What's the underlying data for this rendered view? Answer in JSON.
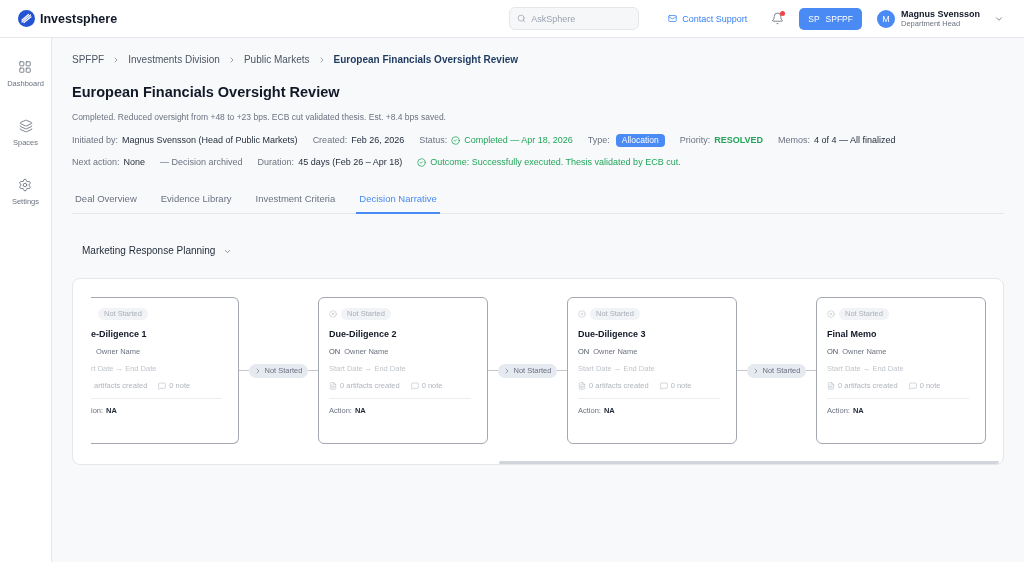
{
  "app": {
    "name": "Investsphere"
  },
  "header": {
    "search": {
      "placeholder": "AskSphere"
    },
    "support_link": "Contact Support",
    "notifications": {
      "unread": true
    },
    "workspace_button": {
      "initials": "SP",
      "label": "SPFPF"
    },
    "user": {
      "initial": "M",
      "name": "Magnus Svensson",
      "role": "Department Head"
    }
  },
  "sidebar": {
    "items": [
      {
        "label": "Dashboard",
        "selected": false
      },
      {
        "label": "Spaces",
        "selected": false
      },
      {
        "label": "Settings",
        "selected": false
      }
    ]
  },
  "breadcrumb": [
    "SPFPF",
    "Investments Division",
    "Public Markets",
    "European Financials Oversight Review"
  ],
  "page": {
    "title": "European Financials Oversight Review",
    "summary": "Completed. Reduced oversight from +48 to +23 bps. ECB cut validated thesis. Est. +8.4 bps saved."
  },
  "meta_rows": [
    {
      "items": [
        {
          "kind": "field",
          "label": "Initiated by:",
          "value": "Magnus Svensson (Head of Public Markets)"
        },
        {
          "kind": "field",
          "label": "Created:",
          "value": "Feb 26, 2026"
        },
        {
          "kind": "status",
          "label": "Status:",
          "value": "Completed — Apr 18, 2026"
        },
        {
          "kind": "badge",
          "label": "Type:",
          "value": "Allocation"
        },
        {
          "kind": "priority",
          "label": "Priority:",
          "value": "RESOLVED"
        },
        {
          "kind": "field",
          "label": "Memos:",
          "value": "4 of 4 — All finalized"
        }
      ]
    },
    {
      "items": [
        {
          "kind": "field",
          "label": "Next action:",
          "value": "None"
        },
        {
          "kind": "note",
          "value": "— Decision archived"
        },
        {
          "kind": "field",
          "label": "Duration:",
          "value": "45 days (Feb 26 – Apr 18)"
        },
        {
          "kind": "status",
          "value": "Outcome: Successfully executed. Thesis validated by ECB cut."
        }
      ]
    }
  ],
  "tabs": [
    {
      "label": "Deal Overview",
      "selected": false
    },
    {
      "label": "Evidence Library",
      "selected": false
    },
    {
      "label": "Investment Criteria",
      "selected": false
    },
    {
      "label": "Decision Narrative",
      "selected": true
    }
  ],
  "plan_selector": {
    "value": "Marketing Response Planning"
  },
  "flow": {
    "stages": [
      {
        "cut_off_left": true,
        "status": "Not Started",
        "title": "e-Diligence 1",
        "owner": "Owner Name",
        "dates": "rt Date → End Date",
        "artifacts": "artifacts created",
        "notes": "0 note",
        "action_label": "ion:",
        "action_value": "NA"
      },
      {
        "cut_off_left": false,
        "status": "Not Started",
        "title": "Due-Diligence 2",
        "owner_initials": "ON",
        "owner": "Owner Name",
        "dates": "Start Date → End Date",
        "artifacts": "0 artifacts created",
        "notes": "0 note",
        "action_label": "Action:",
        "action_value": "NA"
      },
      {
        "cut_off_left": false,
        "status": "Not Started",
        "title": "Due-Diligence 3",
        "owner_initials": "ON",
        "owner": "Owner Name",
        "dates": "Start Date → End Date",
        "artifacts": "0 artifacts created",
        "notes": "0 note",
        "action_label": "Action:",
        "action_value": "NA"
      },
      {
        "cut_off_left": false,
        "status": "Not Started",
        "title": "Final Memo",
        "owner_initials": "ON",
        "owner": "Owner Name",
        "dates": "Start Date → End Date",
        "artifacts": "0 artifacts created",
        "notes": "0 note",
        "action_label": "Action:",
        "action_value": "NA"
      }
    ],
    "connectors": [
      {
        "label": "Not Started"
      },
      {
        "label": "Not Started"
      },
      {
        "label": "Not Started"
      }
    ]
  }
}
